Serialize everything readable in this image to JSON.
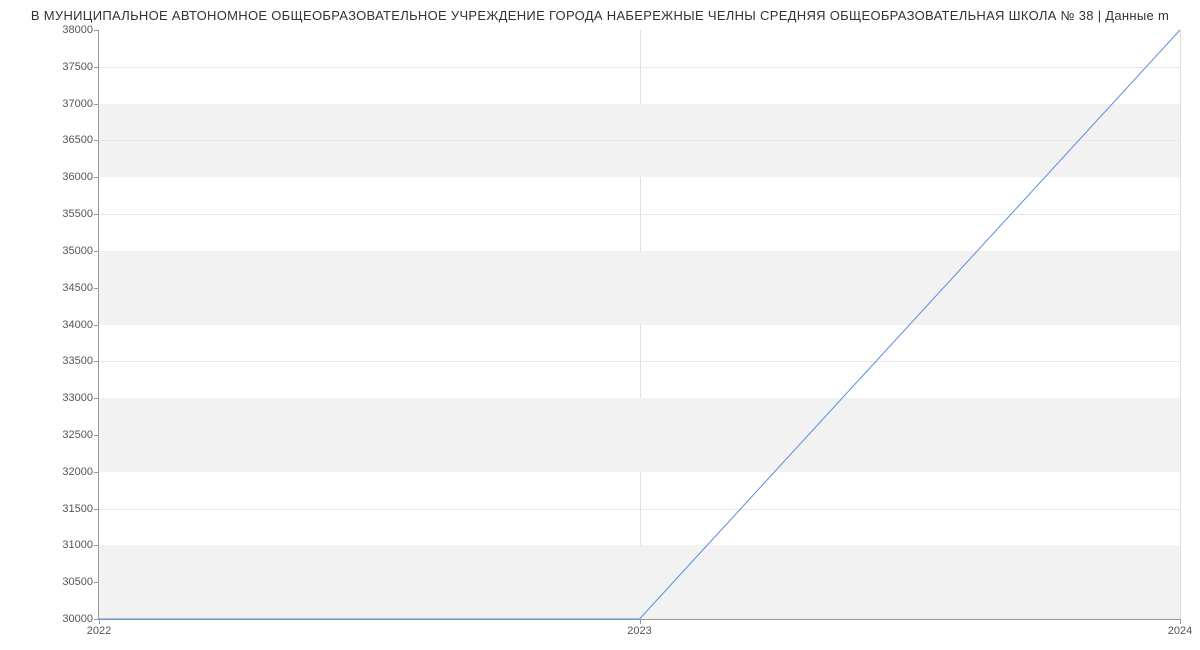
{
  "chart_data": {
    "type": "line",
    "title": "В МУНИЦИПАЛЬНОЕ АВТОНОМНОЕ ОБЩЕОБРАЗОВАТЕЛЬНОЕ УЧРЕЖДЕНИЕ ГОРОДА НАБЕРЕЖНЫЕ ЧЕЛНЫ СРЕДНЯЯ ОБЩЕОБРАЗОВАТЕЛЬНАЯ ШКОЛА № 38 | Данные m",
    "x": [
      2022,
      2023,
      2024
    ],
    "values": [
      30000,
      30000,
      38000
    ],
    "xlabel": "",
    "ylabel": "",
    "xlim": [
      2022,
      2024
    ],
    "ylim": [
      30000,
      38000
    ],
    "x_ticks": [
      2022,
      2023,
      2024
    ],
    "y_ticks": [
      30000,
      30500,
      31000,
      31500,
      32000,
      32500,
      33000,
      33500,
      34000,
      34500,
      35000,
      35500,
      36000,
      36500,
      37000,
      37500,
      38000
    ]
  }
}
